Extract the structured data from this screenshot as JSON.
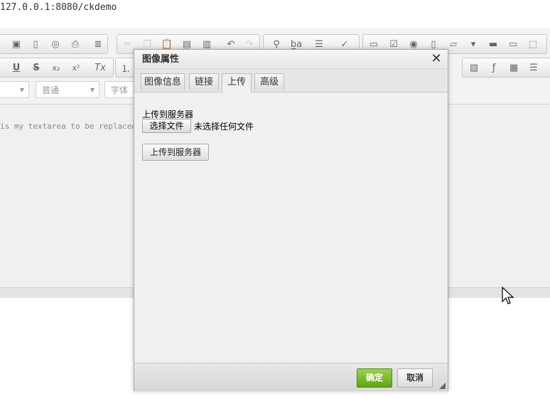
{
  "browser": {
    "url": "127.0.0.1:8080/ckdemo"
  },
  "editor": {
    "combo_format": "普通",
    "combo_font": "字体",
    "content_text": "is my textarea to be replaced",
    "toolbar_icons": [
      "save-icon",
      "new-page-icon",
      "preview-icon",
      "print-icon",
      "templates-icon",
      "cut-icon",
      "copy-icon",
      "paste-icon",
      "paste-text-icon",
      "paste-word-icon",
      "undo-icon",
      "redo-icon",
      "find-icon",
      "replace-icon",
      "select-all-icon",
      "spellcheck-icon",
      "form-icon",
      "checkbox-icon",
      "radio-icon",
      "textfield-icon",
      "textarea-icon",
      "select-icon",
      "button-icon",
      "imagebutton-icon",
      "hiddenfield-icon",
      "underline-icon",
      "strike-icon",
      "subscript-icon",
      "superscript-icon",
      "remove-format-icon",
      "numbered-list-icon",
      "image-icon",
      "flash-icon",
      "table-icon",
      "horizontal-rule-icon"
    ]
  },
  "dialog": {
    "title": "图像属性",
    "tabs": [
      {
        "label": "图像信息",
        "active": false
      },
      {
        "label": "链接",
        "active": false
      },
      {
        "label": "上传",
        "active": true
      },
      {
        "label": "高级",
        "active": false
      }
    ],
    "upload_label": "上传到服务器",
    "file_button": "选择文件",
    "file_none": "未选择任何文件",
    "upload_button": "上传到服务器",
    "ok_button": "确定",
    "cancel_button": "取消",
    "ok_color": "#6ab11c"
  }
}
